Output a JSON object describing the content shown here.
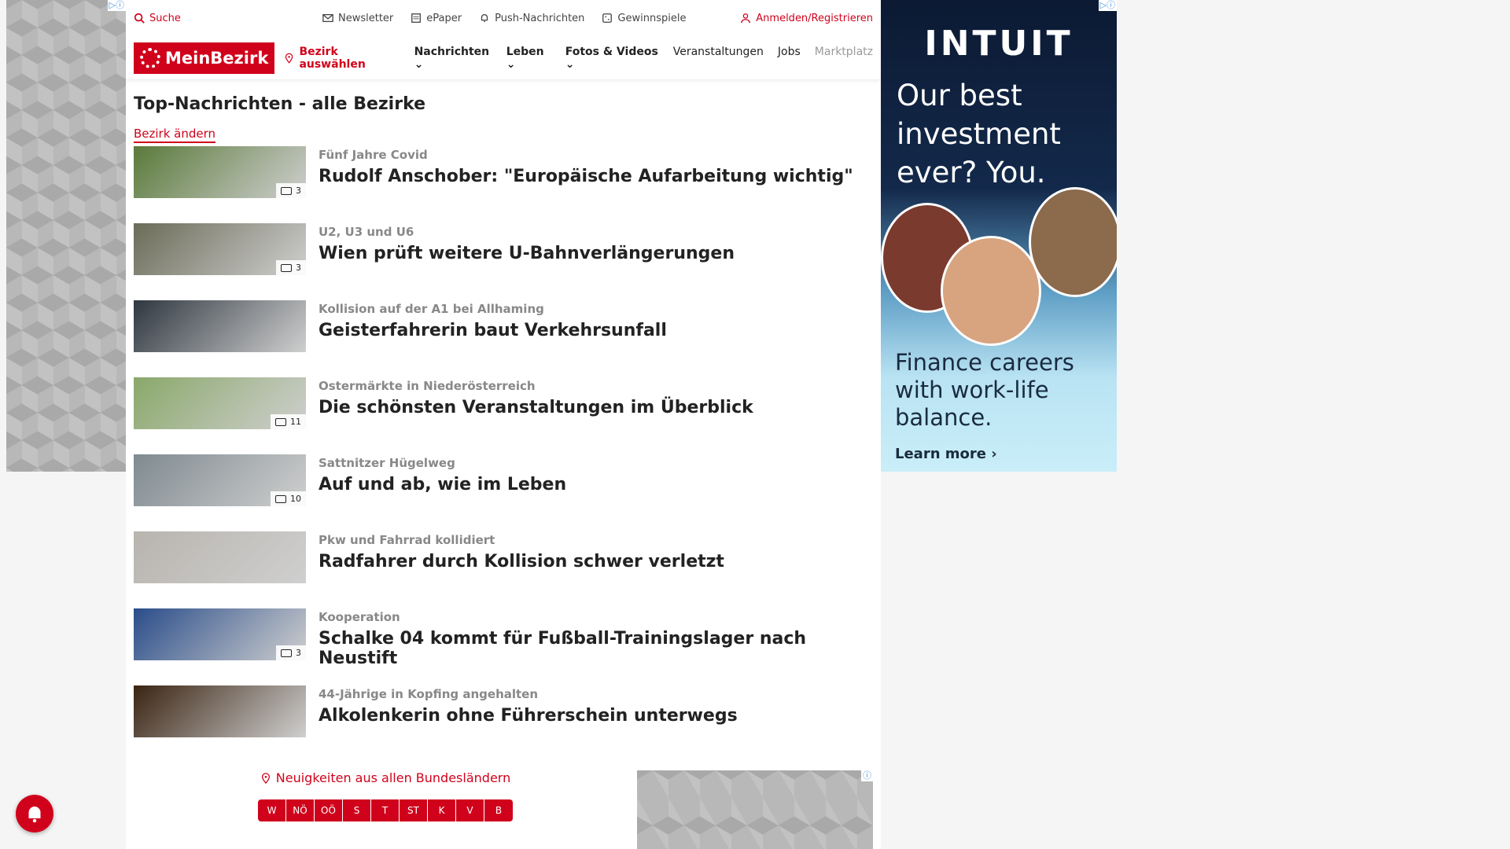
{
  "topbar": {
    "search": "Suche",
    "newsletter": "Newsletter",
    "epaper": "ePaper",
    "push": "Push-Nachrichten",
    "gewinnspiele": "Gewinnspiele",
    "login": "Anmelden/Registrieren"
  },
  "nav": {
    "logo": "MeinBezirk",
    "bezirk": "Bezirk auswählen",
    "items": [
      "Nachrichten",
      "Leben",
      "Fotos & Videos",
      "Veranstaltungen",
      "Jobs",
      "Marktplatz"
    ]
  },
  "page": {
    "title": "Top-Nachrichten - alle Bezirke",
    "change": "Bezirk ändern"
  },
  "articles": [
    {
      "kicker": "Fünf Jahre Covid",
      "headline": "Rudolf Anschober: \"Europäische Aufarbeitung wichtig\"",
      "count": "3",
      "color": "#5a7a3a"
    },
    {
      "kicker": "U2, U3 und U6",
      "headline": "Wien prüft weitere U-Bahnverlängerungen",
      "count": "3",
      "color": "#6b6b58"
    },
    {
      "kicker": "Kollision auf der A1 bei Allhaming",
      "headline": "Geisterfahrerin baut Verkehrsunfall",
      "count": "",
      "color": "#2f3740"
    },
    {
      "kicker": "Ostermärkte in Niederösterreich",
      "headline": "Die schönsten Veranstaltungen im Überblick",
      "count": "11",
      "color": "#8aa86a"
    },
    {
      "kicker": "Sattnitzer Hügelweg",
      "headline": "Auf und ab, wie im Leben",
      "count": "10",
      "color": "#7f8a90"
    },
    {
      "kicker": "Pkw und Fahrrad kollidiert",
      "headline": "Radfahrer durch Kollision schwer verletzt",
      "count": "",
      "color": "#b8b4ae"
    },
    {
      "kicker": "Kooperation",
      "headline": "Schalke 04 kommt für Fußball-Trainingslager nach Neustift",
      "count": "3",
      "color": "#2a4d8a"
    },
    {
      "kicker": "44-Jährige in Kopfing angehalten",
      "headline": "Alkolenkerin ohne Führerschein unterwegs",
      "count": "",
      "color": "#3a2412"
    }
  ],
  "regions": {
    "label": "Neuigkeiten aus allen Bundesländern",
    "chips": [
      "W",
      "NÖ",
      "OÖ",
      "S",
      "T",
      "ST",
      "K",
      "V",
      "B"
    ]
  },
  "ad_right": {
    "brand": "INTUIT",
    "claim": "Our best investment ever? You.",
    "claim2": "Finance careers with work-life balance.",
    "cta": "Learn more ›"
  },
  "colors": {
    "brand": "#d0021b"
  }
}
